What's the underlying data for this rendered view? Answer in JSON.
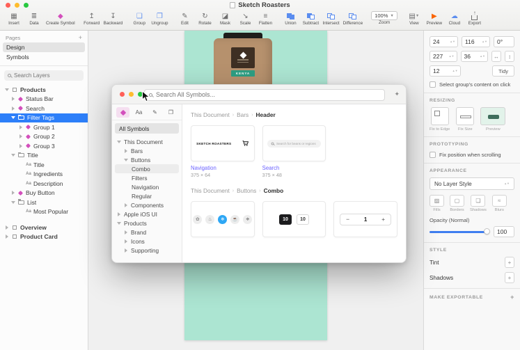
{
  "window": {
    "title": "Sketch Roasters"
  },
  "colors": {
    "accent_pink": "#d34fbc",
    "selection_blue": "#2d7ff9",
    "artboard_mint": "#ace5d2",
    "symbol_label_purple": "#6c63ff"
  },
  "toolbar": {
    "items": [
      "Insert",
      "Data",
      "Create Symbol",
      "Forward",
      "Backward",
      "Group",
      "Ungroup",
      "Edit",
      "Rotate",
      "Mask",
      "Scale",
      "Flatten",
      "Union",
      "Subtract",
      "Intersect",
      "Difference",
      "Zoom",
      "View",
      "Preview",
      "Cloud",
      "Export"
    ],
    "zoom_value": "100%"
  },
  "sidebar": {
    "pages_header": "Pages",
    "pages": [
      {
        "label": "Design"
      },
      {
        "label": "Symbols"
      }
    ],
    "search_placeholder": "Search Layers",
    "layers": [
      {
        "label": "Products"
      },
      {
        "label": "Status Bar"
      },
      {
        "label": "Search"
      },
      {
        "label": "Filter Tags"
      },
      {
        "label": "Group 1"
      },
      {
        "label": "Group 2"
      },
      {
        "label": "Group 3"
      },
      {
        "label": "Title"
      },
      {
        "label": "Title"
      },
      {
        "label": "Ingredients"
      },
      {
        "label": "Description"
      },
      {
        "label": "Buy Button"
      },
      {
        "label": "List"
      },
      {
        "label": "Most Popular"
      },
      {
        "label": "Overview"
      },
      {
        "label": "Product Card"
      }
    ]
  },
  "canvas": {
    "bag_label": "KENYA"
  },
  "symbols_window": {
    "search_placeholder": "Search All Symbols...",
    "all_symbols_label": "All Symbols",
    "tree": [
      {
        "label": "This Document"
      },
      {
        "label": "Bars"
      },
      {
        "label": "Buttons"
      },
      {
        "label": "Combo"
      },
      {
        "label": "Filters"
      },
      {
        "label": "Navigation"
      },
      {
        "label": "Regular"
      },
      {
        "label": "Components"
      },
      {
        "label": "Apple iOS UI"
      },
      {
        "label": "Products"
      },
      {
        "label": "Brand"
      },
      {
        "label": "Icons"
      },
      {
        "label": "Supporting"
      }
    ],
    "sections": [
      {
        "breadcrumb": [
          "This Document",
          "Bars",
          "Header"
        ],
        "items": [
          {
            "name": "Navigation",
            "size": "375 × 64",
            "brand": "SKETCH ROASTERS"
          },
          {
            "name": "Search",
            "size": "375 × 48",
            "placeholder": "Search for beans or regions"
          }
        ]
      },
      {
        "breadcrumb": [
          "This Document",
          "Buttons",
          "Combo"
        ],
        "toggle": [
          "10",
          "10"
        ],
        "stepper": {
          "minus": "−",
          "value": "1",
          "plus": "+"
        }
      }
    ]
  },
  "inspector": {
    "x": "24",
    "y": "116",
    "rotation": "0°",
    "width": "227",
    "height": "36",
    "radius": "12",
    "tidy": "Tidy",
    "group_click": "Select group's content on click",
    "resizing_header": "RESIZING",
    "resizing_options": [
      "Fix to Edge",
      "Fix Size",
      "Preview"
    ],
    "prototyping_header": "PROTOTYPING",
    "prototyping_fix": "Fix position when scrolling",
    "appearance_header": "APPEARANCE",
    "layer_style": "No Layer Style",
    "quick": [
      "Fills",
      "Borders",
      "Shadows",
      "Blurs"
    ],
    "opacity_label": "Opacity (Normal)",
    "opacity_value": "100",
    "style_header": "STYLE",
    "style_rows": [
      "Tint",
      "Shadows"
    ],
    "export_header": "MAKE EXPORTABLE"
  }
}
